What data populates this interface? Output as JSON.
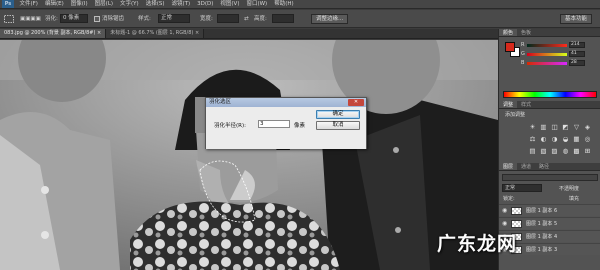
{
  "menubar": {
    "logo": "Ps",
    "items": [
      "文件(F)",
      "编辑(E)",
      "图像(I)",
      "图层(L)",
      "文字(Y)",
      "选择(S)",
      "滤镜(T)",
      "3D(D)",
      "视图(V)",
      "窗口(W)",
      "帮助(H)"
    ]
  },
  "options": {
    "feather_label": "羽化:",
    "feather_value": "0 像素",
    "antialias_label": "消除锯齿",
    "style_label": "样式:",
    "style_value": "正常",
    "width_label": "宽度:",
    "height_label": "高度:",
    "refine_button": "调整边缘...",
    "workspace_button": "基本功能"
  },
  "tabs": [
    {
      "label": "083.jpg @ 200% (背景 副本, RGB/8#) ×",
      "active": true
    },
    {
      "label": "未标题-1 @ 66.7% (图层 1, RGB/8) ×",
      "active": false
    }
  ],
  "dialog": {
    "title": "羽化选区",
    "close": "✕",
    "radius_label": "羽化半径(R):",
    "radius_value": "3",
    "unit": "像素",
    "ok": "确定",
    "cancel": "取消"
  },
  "color_panel": {
    "tabs": [
      "颜色",
      "色板"
    ],
    "channels": [
      {
        "label": "R",
        "value": "214"
      },
      {
        "label": "G",
        "value": "41"
      },
      {
        "label": "B",
        "value": "28"
      }
    ],
    "foreground_color": "#d6291c",
    "background_color": "#ffffff"
  },
  "adjust_panel": {
    "tabs": [
      "调整",
      "样式"
    ],
    "title": "添加调整",
    "icons": [
      "☀",
      "▥",
      "◫",
      "◩",
      "▽",
      "◈",
      "⚖",
      "◐",
      "◑",
      "◒",
      "▦",
      "◎",
      "▤",
      "▧",
      "▨",
      "◍",
      "▩",
      "⊞"
    ]
  },
  "layers_panel": {
    "tabs": [
      "图层",
      "通道",
      "路径"
    ],
    "blend_mode": "正常",
    "opacity_label": "不透明度",
    "lock_label": "锁定:",
    "fill_label": "填充",
    "layers": [
      "图层 1 副本 6",
      "图层 1 副本 5",
      "图层 1 副本 4",
      "图层 1 副本 3"
    ]
  },
  "watermark": "广东龙网"
}
